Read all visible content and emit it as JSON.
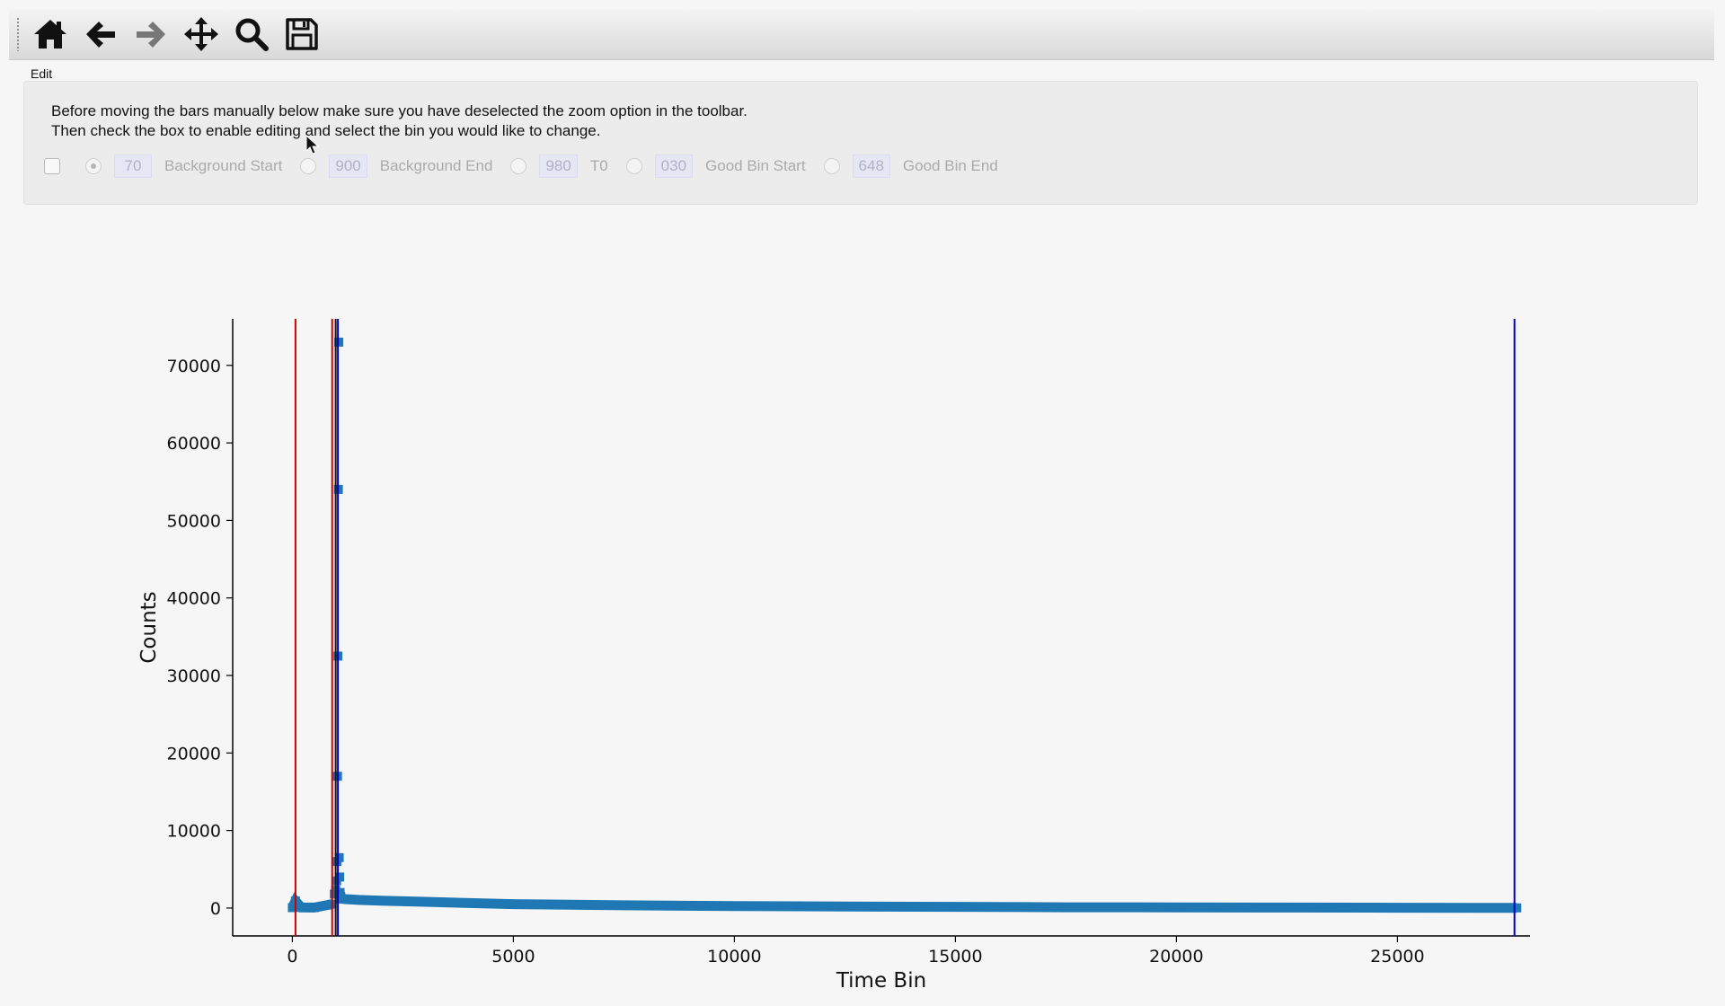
{
  "toolbar": {
    "buttons": [
      {
        "name": "home-icon"
      },
      {
        "name": "back-arrow-icon"
      },
      {
        "name": "forward-arrow-icon"
      },
      {
        "name": "pan-icon"
      },
      {
        "name": "zoom-icon"
      },
      {
        "name": "save-icon"
      }
    ]
  },
  "edit_label": "Edit",
  "instructions": {
    "line1": "Before moving the bars manually below make sure you have deselected the zoom option in the toolbar.",
    "line2": "Then check the box to enable editing and select the bin you would like to change."
  },
  "controls": {
    "enable_checked": false,
    "items": [
      {
        "value": "70",
        "label": "Background Start",
        "selected": true
      },
      {
        "value": "900",
        "label": "Background End",
        "selected": false
      },
      {
        "value": "980",
        "label": "T0",
        "selected": false
      },
      {
        "value": "030",
        "label": "Good Bin Start",
        "selected": false
      },
      {
        "value": "648",
        "label": "Good Bin End",
        "selected": false
      }
    ]
  },
  "colors": {
    "data": "#1f77b4",
    "red_line": "#cc0000",
    "blue_line": "#0000cc"
  },
  "chart_data": {
    "type": "scatter",
    "title": "",
    "xlabel": "Time Bin",
    "ylabel": "Counts",
    "xlim": [
      -1350,
      28000
    ],
    "ylim": [
      -3600,
      76000
    ],
    "xticks": [
      0,
      5000,
      10000,
      15000,
      20000,
      25000
    ],
    "yticks": [
      0,
      10000,
      20000,
      30000,
      40000,
      50000,
      60000,
      70000
    ],
    "grid": false,
    "series": [
      {
        "marker": "square",
        "x": [
          0,
          70,
          200,
          500,
          900,
          950,
          980,
          1000,
          1010,
          1020,
          1030,
          1040,
          1050,
          1060,
          1070,
          1080,
          1100,
          1200,
          1500,
          2000,
          3000,
          5000,
          7500,
          10000,
          12500,
          15000,
          17500,
          20000,
          22500,
          25000,
          27700
        ],
        "y": [
          50,
          900,
          80,
          60,
          500,
          1800,
          2300,
          3500,
          6000,
          17000,
          32500,
          54000,
          73000,
          6500,
          4000,
          2000,
          1200,
          1150,
          1050,
          950,
          800,
          500,
          350,
          250,
          200,
          150,
          100,
          80,
          60,
          40,
          20
        ]
      }
    ],
    "vertical_lines": [
      {
        "x": 70,
        "color": "red"
      },
      {
        "x": 900,
        "color": "red"
      },
      {
        "x": 980,
        "color": "black"
      },
      {
        "x": 1030,
        "color": "blue"
      },
      {
        "x": 27648,
        "color": "blue"
      }
    ]
  }
}
